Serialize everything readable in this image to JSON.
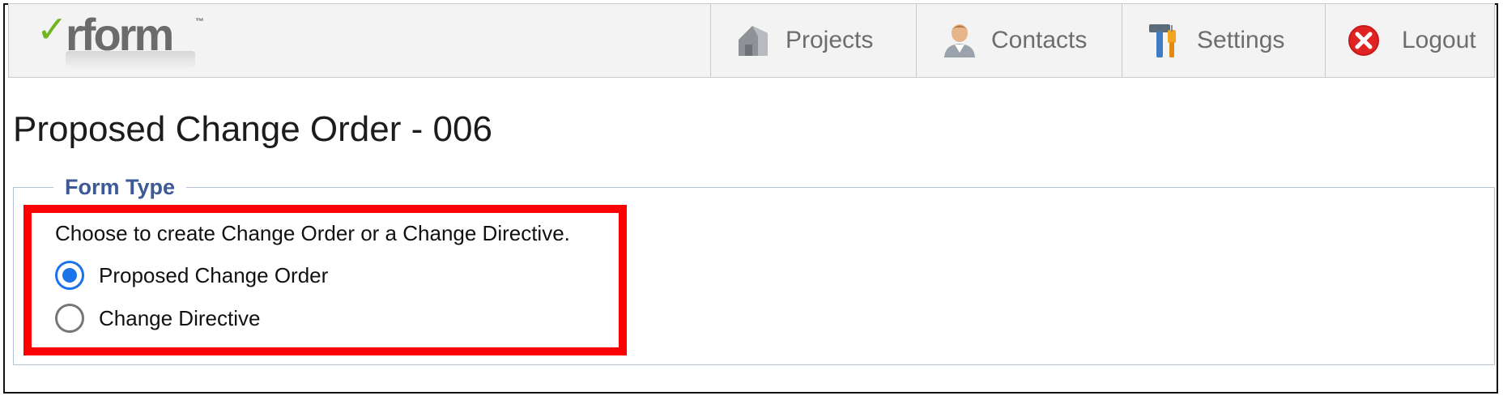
{
  "app": {
    "logo_text": "rform",
    "logo_check": "✓",
    "logo_tm": "™"
  },
  "nav": {
    "items": [
      {
        "label": "Projects",
        "icon": "house-icon"
      },
      {
        "label": "Contacts",
        "icon": "person-icon"
      },
      {
        "label": "Settings",
        "icon": "tools-icon"
      },
      {
        "label": "Logout",
        "icon": "close-circle-icon"
      }
    ]
  },
  "page": {
    "title": "Proposed Change Order - 006"
  },
  "form_type": {
    "legend": "Form Type",
    "instructions": "Choose to create Change Order or a Change Directive.",
    "options": [
      {
        "label": "Proposed Change Order",
        "selected": true
      },
      {
        "label": "Change Directive",
        "selected": false
      }
    ]
  },
  "colors": {
    "accent": "#1a73e8",
    "legend": "#3d5a96",
    "highlight": "#ff0000",
    "logo_check": "#6fb51f",
    "logout": "#e02424"
  }
}
